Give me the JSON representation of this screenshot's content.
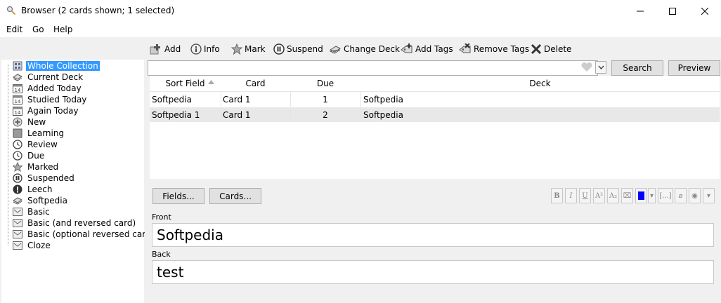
{
  "window": {
    "title": "Browser (2 cards shown; 1 selected)"
  },
  "menu": [
    "Edit",
    "Go",
    "Help"
  ],
  "toolbar": {
    "add": "Add",
    "info": "Info",
    "mark": "Mark",
    "suspend": "Suspend",
    "change_deck": "Change Deck",
    "add_tags": "Add Tags",
    "remove_tags": "Remove Tags",
    "delete": "Delete"
  },
  "sidebar": {
    "items": [
      {
        "label": "Whole Collection",
        "icon": "collection-icon",
        "selected": true
      },
      {
        "label": "Current Deck",
        "icon": "deck-icon"
      },
      {
        "label": "Added Today",
        "icon": "calendar-icon"
      },
      {
        "label": "Studied Today",
        "icon": "calendar-icon"
      },
      {
        "label": "Again Today",
        "icon": "calendar-icon"
      },
      {
        "label": "New",
        "icon": "plus-circle-icon"
      },
      {
        "label": "Learning",
        "icon": "learning-icon"
      },
      {
        "label": "Review",
        "icon": "clock-icon"
      },
      {
        "label": "Due",
        "icon": "clock-icon"
      },
      {
        "label": "Marked",
        "icon": "star-icon"
      },
      {
        "label": "Suspended",
        "icon": "pause-icon"
      },
      {
        "label": "Leech",
        "icon": "exclamation-icon"
      },
      {
        "label": "Softpedia",
        "icon": "deck-icon"
      },
      {
        "label": "Basic",
        "icon": "note-type-icon"
      },
      {
        "label": "Basic (and reversed card)",
        "icon": "note-type-icon"
      },
      {
        "label": "Basic (optional reversed card)",
        "icon": "note-type-icon"
      },
      {
        "label": "Cloze",
        "icon": "note-type-icon"
      }
    ]
  },
  "search": {
    "value": "",
    "search_button": "Search",
    "preview_button": "Preview"
  },
  "table": {
    "headers": [
      "Sort Field",
      "Card",
      "Due",
      "Deck"
    ],
    "rows": [
      [
        "Softpedia",
        "Card 1",
        "1",
        "Softpedia"
      ],
      [
        "Softpedia 1",
        "Card 1",
        "2",
        "Softpedia"
      ]
    ]
  },
  "editor": {
    "fields_button": "Fields...",
    "cards_button": "Cards...",
    "front_label": "Front",
    "front_value": "Softpedia",
    "back_label": "Back",
    "back_value": "test"
  },
  "colors": {
    "selection": "#3399ff",
    "accent": "#0000ff"
  }
}
